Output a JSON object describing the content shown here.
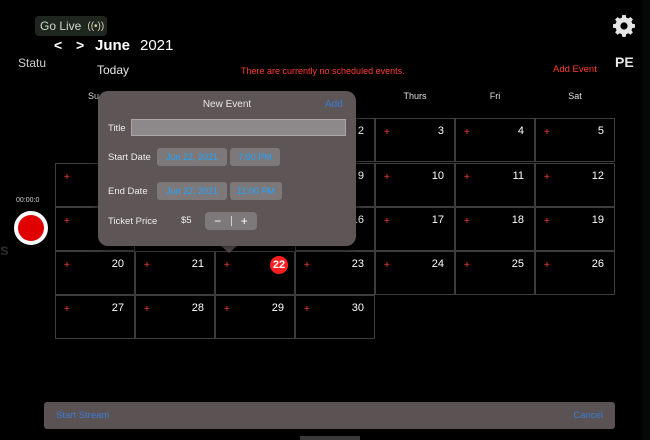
{
  "header": {
    "go_live_label": "Go Live",
    "signal_glyph": "((•))",
    "prev_glyph": "<",
    "next_glyph": ">",
    "month": "June",
    "year": "2021",
    "today_label": "Today",
    "notice": "There are currently no scheduled events.",
    "add_event_label": "Add Event"
  },
  "side": {
    "status_label": "Statu",
    "pe_label": "PE",
    "record_time": "00:00:0",
    "edge_letter": "s"
  },
  "weekdays": [
    "Su",
    "Thurs",
    "Fri",
    "Sat"
  ],
  "calendar": {
    "plus_glyph": "+",
    "row1": [
      "2",
      "3",
      "4",
      "5"
    ],
    "row2": [
      "9",
      "10",
      "11",
      "12"
    ],
    "row3": [
      "16",
      "17",
      "18",
      "19"
    ],
    "row4": [
      "20",
      "21",
      "22",
      "23",
      "24",
      "25",
      "26"
    ],
    "row5": [
      "27",
      "28",
      "29",
      "30"
    ],
    "today": "22"
  },
  "popover": {
    "title": "New Event",
    "add_label": "Add",
    "title_label": "Title",
    "title_value": "",
    "start_date_label": "Start Date",
    "start_date": "Jun 22, 2021",
    "start_time": "7:00 PM",
    "end_date_label": "End Date",
    "end_date": "Jun 22, 2021",
    "end_time": "11:00 PM",
    "ticket_price_label": "Ticket Price",
    "ticket_price": "$5",
    "minus_glyph": "−",
    "plus_glyph": "+"
  },
  "bottom": {
    "start_stream_label": "Start Stream",
    "cancel_label": "Cancel"
  },
  "colors": {
    "accent_red": "#ff3b30",
    "link_blue": "#3a7bd5",
    "today_badge": "#ff1f1f"
  }
}
